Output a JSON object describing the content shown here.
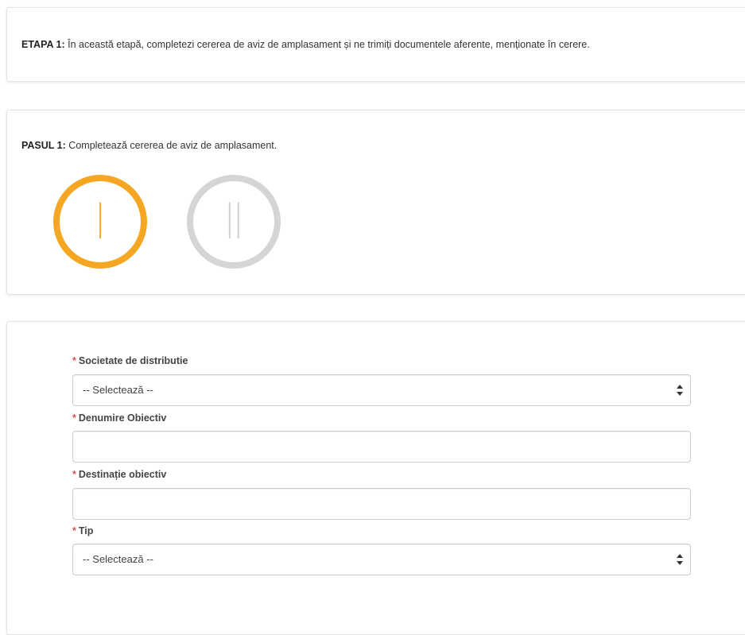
{
  "etapa": {
    "label": "ETAPA 1:",
    "text": "În această etapă, completezi cererea de aviz de amplasament și ne trimiți documentele aferente, menționate în cerere."
  },
  "pasul": {
    "label": "PASUL 1:",
    "text": "Completează cererea de aviz de amplasament.",
    "steps": [
      {
        "numeral": "I",
        "state": "active",
        "color": "#f5a623"
      },
      {
        "numeral": "II",
        "state": "inactive",
        "color": "#d5d5d5"
      }
    ]
  },
  "form": {
    "required_mark": "*",
    "societate": {
      "label": "Societate de distributie",
      "value": "-- Selectează --"
    },
    "denumire": {
      "label": "Denumire Obiectiv",
      "value": ""
    },
    "destinatie": {
      "label": "Destinație obiectiv",
      "value": ""
    },
    "tip": {
      "label": "Tip",
      "value": "-- Selectează --"
    }
  }
}
